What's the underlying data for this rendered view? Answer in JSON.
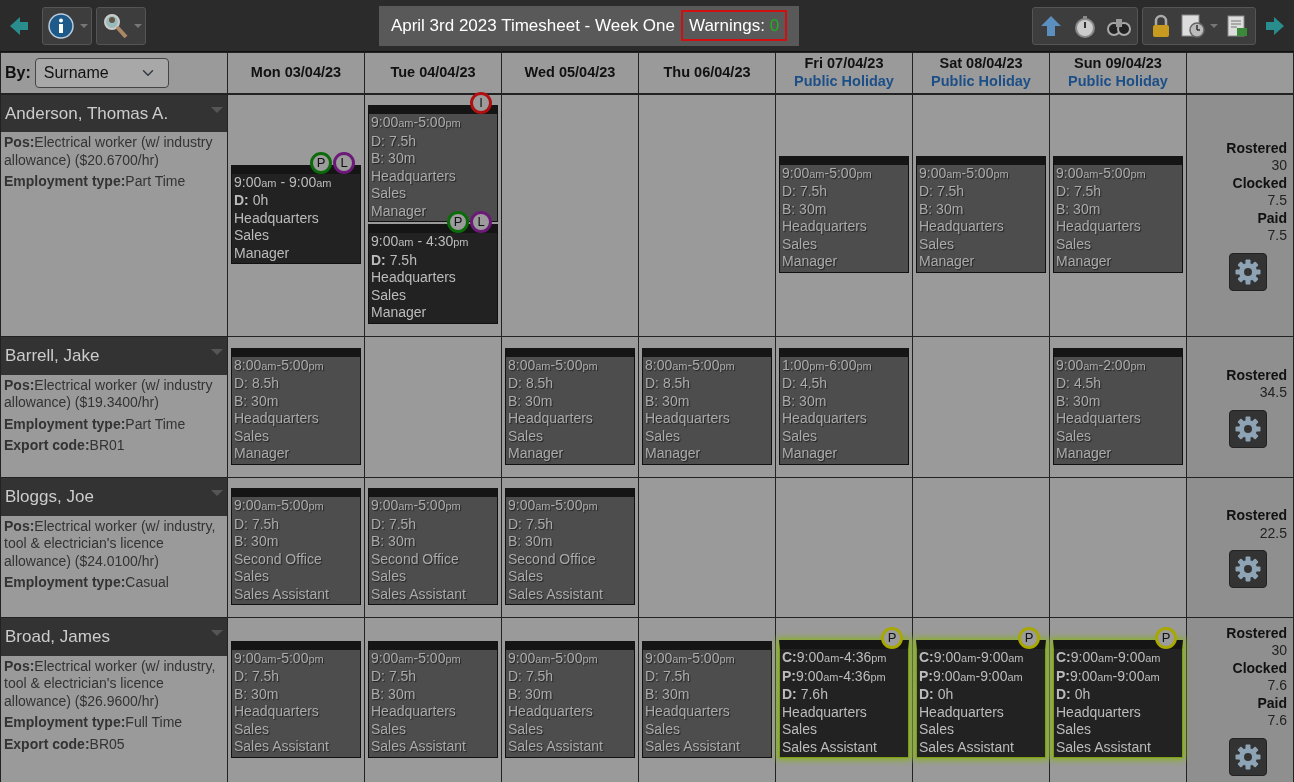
{
  "toolbar": {
    "title": "April 3rd 2023 Timesheet - Week One",
    "warnings_label": "Warnings:",
    "warnings_count": "0"
  },
  "sort": {
    "label": "By:",
    "value": "Surname"
  },
  "days": [
    {
      "label": "Mon 03/04/23"
    },
    {
      "label": "Tue 04/04/23"
    },
    {
      "label": "Wed 05/04/23"
    },
    {
      "label": "Thu 06/04/23"
    },
    {
      "label": "Fri 07/04/23",
      "note": "Public Holiday"
    },
    {
      "label": "Sat 08/04/23",
      "note": "Public Holiday"
    },
    {
      "label": "Sun 09/04/23",
      "note": "Public Holiday"
    }
  ],
  "employees": [
    {
      "name": "Anderson, Thomas A.",
      "details": [
        "**Pos:**Electrical worker (w/ industry allowance) ($20.6700/hr)",
        "**Employment type:**Part Time"
      ],
      "cells": [
        {
          "kind": "shifts",
          "shifts": [
            {
              "kind": "worked",
              "highlighted": false,
              "badges": [
                {
                  "letter": "P",
                  "color": "#0b6b0b"
                },
                {
                  "letter": "L",
                  "color": "#6b1a78"
                }
              ],
              "lines": [
                "9:00am - 9:00am",
                "**D:** 0h",
                "Headquarters",
                "Sales",
                "Manager"
              ]
            }
          ]
        },
        {
          "kind": "shifts",
          "shifts": [
            {
              "kind": "rostered",
              "highlighted": false,
              "badges": [
                {
                  "letter": "I",
                  "color": "#b01010"
                }
              ],
              "lines": [
                "9:00am-5:00pm",
                "D: 7.5h",
                "B: 30m",
                "Headquarters",
                "Sales",
                "Manager"
              ]
            },
            {
              "kind": "worked",
              "highlighted": false,
              "badges": [
                {
                  "letter": "P",
                  "color": "#0b6b0b"
                },
                {
                  "letter": "L",
                  "color": "#6b1a78"
                }
              ],
              "lines": [
                "9:00am - 4:30pm",
                "**D:** 7.5h",
                "Headquarters",
                "Sales",
                "Manager"
              ]
            }
          ]
        },
        {
          "kind": "empty"
        },
        {
          "kind": "empty"
        },
        {
          "kind": "shifts",
          "shifts": [
            {
              "kind": "rostered",
              "highlighted": false,
              "lines": [
                "9:00am-5:00pm",
                "D: 7.5h",
                "B: 30m",
                "Headquarters",
                "Sales",
                "Manager"
              ]
            }
          ]
        },
        {
          "kind": "shifts",
          "shifts": [
            {
              "kind": "rostered",
              "highlighted": false,
              "lines": [
                "9:00am-5:00pm",
                "D: 7.5h",
                "B: 30m",
                "Headquarters",
                "Sales",
                "Manager"
              ]
            }
          ]
        },
        {
          "kind": "shifts",
          "shifts": [
            {
              "kind": "rostered",
              "highlighted": false,
              "lines": [
                "9:00am-5:00pm",
                "D: 7.5h",
                "B: 30m",
                "Headquarters",
                "Sales",
                "Manager"
              ]
            }
          ]
        }
      ],
      "summary": [
        {
          "label": "Rostered",
          "value": "30"
        },
        {
          "label": "Clocked",
          "value": "7.5"
        },
        {
          "label": "Paid",
          "value": "7.5"
        }
      ]
    },
    {
      "name": "Barrell, Jake",
      "details": [
        "**Pos:**Electrical worker (w/ industry allowance) ($19.3400/hr)",
        "**Employment type:**Part Time",
        "**Export code:**BR01"
      ],
      "cells": [
        {
          "kind": "shifts",
          "shifts": [
            {
              "kind": "rostered",
              "highlighted": false,
              "lines": [
                "8:00am-5:00pm",
                "D: 8.5h",
                "B: 30m",
                "Headquarters",
                "Sales",
                "Manager"
              ]
            }
          ]
        },
        {
          "kind": "empty"
        },
        {
          "kind": "shifts",
          "shifts": [
            {
              "kind": "rostered",
              "highlighted": false,
              "lines": [
                "8:00am-5:00pm",
                "D: 8.5h",
                "B: 30m",
                "Headquarters",
                "Sales",
                "Manager"
              ]
            }
          ]
        },
        {
          "kind": "shifts",
          "shifts": [
            {
              "kind": "rostered",
              "highlighted": false,
              "lines": [
                "8:00am-5:00pm",
                "D: 8.5h",
                "B: 30m",
                "Headquarters",
                "Sales",
                "Manager"
              ]
            }
          ]
        },
        {
          "kind": "shifts",
          "shifts": [
            {
              "kind": "rostered",
              "highlighted": false,
              "lines": [
                "1:00pm-6:00pm",
                "D: 4.5h",
                "B: 30m",
                "Headquarters",
                "Sales",
                "Manager"
              ]
            }
          ]
        },
        {
          "kind": "empty"
        },
        {
          "kind": "shifts",
          "shifts": [
            {
              "kind": "rostered",
              "highlighted": false,
              "lines": [
                "9:00am-2:00pm",
                "D: 4.5h",
                "B: 30m",
                "Headquarters",
                "Sales",
                "Manager"
              ]
            }
          ]
        }
      ],
      "summary": [
        {
          "label": "Rostered",
          "value": "34.5"
        }
      ]
    },
    {
      "name": "Bloggs, Joe",
      "details": [
        "**Pos:**Electrical worker (w/ industry, tool & electrician's licence allowance) ($24.0100/hr)",
        "**Employment type:**Casual"
      ],
      "cells": [
        {
          "kind": "shifts",
          "shifts": [
            {
              "kind": "rostered",
              "highlighted": false,
              "lines": [
                "9:00am-5:00pm",
                "D: 7.5h",
                "B: 30m",
                "Second Office",
                "Sales",
                "Sales Assistant"
              ]
            }
          ]
        },
        {
          "kind": "shifts",
          "shifts": [
            {
              "kind": "rostered",
              "highlighted": false,
              "lines": [
                "9:00am-5:00pm",
                "D: 7.5h",
                "B: 30m",
                "Second Office",
                "Sales",
                "Sales Assistant"
              ]
            }
          ]
        },
        {
          "kind": "shifts",
          "shifts": [
            {
              "kind": "rostered",
              "highlighted": false,
              "lines": [
                "9:00am-5:00pm",
                "D: 7.5h",
                "B: 30m",
                "Second Office",
                "Sales",
                "Sales Assistant"
              ]
            }
          ]
        },
        {
          "kind": "empty"
        },
        {
          "kind": "empty"
        },
        {
          "kind": "empty"
        },
        {
          "kind": "empty"
        }
      ],
      "summary": [
        {
          "label": "Rostered",
          "value": "22.5"
        }
      ]
    },
    {
      "name": "Broad, James",
      "details": [
        "**Pos:**Electrical worker (w/ industry, tool & electrician's licence allowance) ($26.9600/hr)",
        "**Employment type:**Full Time",
        "**Export code:**BR05"
      ],
      "cells": [
        {
          "kind": "shifts",
          "shifts": [
            {
              "kind": "rostered",
              "highlighted": false,
              "lines": [
                "9:00am-5:00pm",
                "D: 7.5h",
                "B: 30m",
                "Headquarters",
                "Sales",
                "Sales Assistant"
              ]
            }
          ]
        },
        {
          "kind": "shifts",
          "shifts": [
            {
              "kind": "rostered",
              "highlighted": false,
              "lines": [
                "9:00am-5:00pm",
                "D: 7.5h",
                "B: 30m",
                "Headquarters",
                "Sales",
                "Sales Assistant"
              ]
            }
          ]
        },
        {
          "kind": "shifts",
          "shifts": [
            {
              "kind": "rostered",
              "highlighted": false,
              "lines": [
                "9:00am-5:00pm",
                "D: 7.5h",
                "B: 30m",
                "Headquarters",
                "Sales",
                "Sales Assistant"
              ]
            }
          ]
        },
        {
          "kind": "shifts",
          "shifts": [
            {
              "kind": "rostered",
              "highlighted": false,
              "lines": [
                "9:00am-5:00pm",
                "D: 7.5h",
                "B: 30m",
                "Headquarters",
                "Sales",
                "Sales Assistant"
              ]
            }
          ]
        },
        {
          "kind": "shifts",
          "shifts": [
            {
              "kind": "worked",
              "highlighted": true,
              "badges": [
                {
                  "letter": "P",
                  "color": "#a8a800"
                }
              ],
              "lines": [
                "**C:**9:00am-4:36pm",
                "**P:**9:00am-4:36pm",
                "**D:** 7.6h",
                "Headquarters",
                "Sales",
                "Sales Assistant"
              ]
            }
          ]
        },
        {
          "kind": "shifts",
          "shifts": [
            {
              "kind": "worked",
              "highlighted": true,
              "badges": [
                {
                  "letter": "P",
                  "color": "#a8a800"
                }
              ],
              "lines": [
                "**C:**9:00am-9:00am",
                "**P:**9:00am-9:00am",
                "**D:** 0h",
                "Headquarters",
                "Sales",
                "Sales Assistant"
              ]
            }
          ]
        },
        {
          "kind": "shifts",
          "shifts": [
            {
              "kind": "worked",
              "highlighted": true,
              "badges": [
                {
                  "letter": "P",
                  "color": "#a8a800"
                }
              ],
              "lines": [
                "**C:**9:00am-9:00am",
                "**P:**9:00am-9:00am",
                "**D:** 0h",
                "Headquarters",
                "Sales",
                "Sales Assistant"
              ]
            }
          ]
        }
      ],
      "summary": [
        {
          "label": "Rostered",
          "value": "30"
        },
        {
          "label": "Clocked",
          "value": "7.6"
        },
        {
          "label": "Paid",
          "value": "7.6"
        }
      ]
    }
  ]
}
